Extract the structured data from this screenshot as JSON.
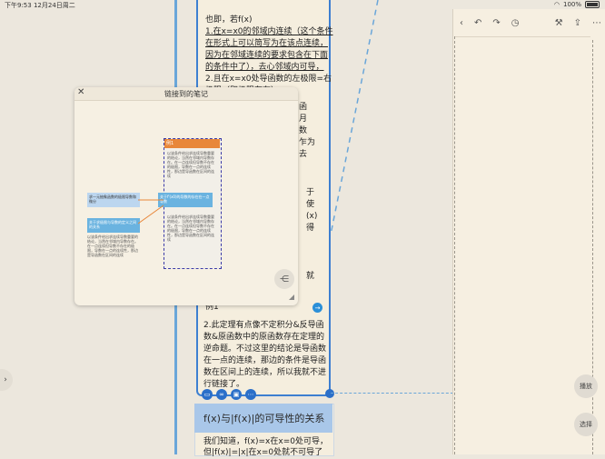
{
  "status": {
    "time": "下午9:53",
    "date": "12月24日周二",
    "battery": "100%"
  },
  "card": {
    "lines": [
      {
        "text": "也即，若f(x)",
        "u": false
      },
      {
        "text": "1.在x=x0的邻域内连续（这个条件",
        "u": true
      },
      {
        "text": "在形式上可以简写为在该点连续，",
        "u": true
      },
      {
        "text": "因为在邻域连续的要求包含在下面",
        "u": true
      },
      {
        "text": "的条件中了），去心邻域内可导，",
        "u": true
      },
      {
        "text": "2.且在x=x0处导函数的左极限=右",
        "u": false
      },
      {
        "text": "极限（即极限存在）",
        "u": false
      }
    ],
    "right_fragments": [
      "函",
      "月",
      "数",
      "乍为",
      "去",
      "于",
      "使",
      "(x)",
      "得",
      "就"
    ],
    "example_label": "例1",
    "para2": [
      "2.此定理有点像不定积分&反导函",
      "数&原函数中的原函数存在定理的",
      "逆命题。不过这里的结论是导函数",
      "在一点的连续，那边的条件是导函",
      "数在区间上的连续，所以我就不进",
      "行链接了。"
    ]
  },
  "blue_card": {
    "title": "f(x)与|f(x)|的可导性的关系",
    "lines": [
      "我们知道，f(x)=x在x=0处可导，",
      "但|f(x)|=|x|在x=0处就不可导了"
    ]
  },
  "popup": {
    "title": "链接到的笔记",
    "mini_orange_title": "例1",
    "mini_box1": "求一元抽象函数的极限导数和微分",
    "mini_box2": "关于f'(x0)的导数的存在在一点导数",
    "mini_box3": "关于求极限与导数的定义之间的关系",
    "mini_body": "以该条件给出求连续导数重要的结论，当然在邻域内导数存在。在一点连续但导数不存在的极限，导数在一点的连续性，那边是导函数在区间的连续"
  },
  "right_panel": {
    "buttons": [
      "播放",
      "选择"
    ]
  },
  "colors": {
    "card_border": "#3d7fd1",
    "blue_header": "#a9c7e9",
    "orange": "#e8873a"
  }
}
